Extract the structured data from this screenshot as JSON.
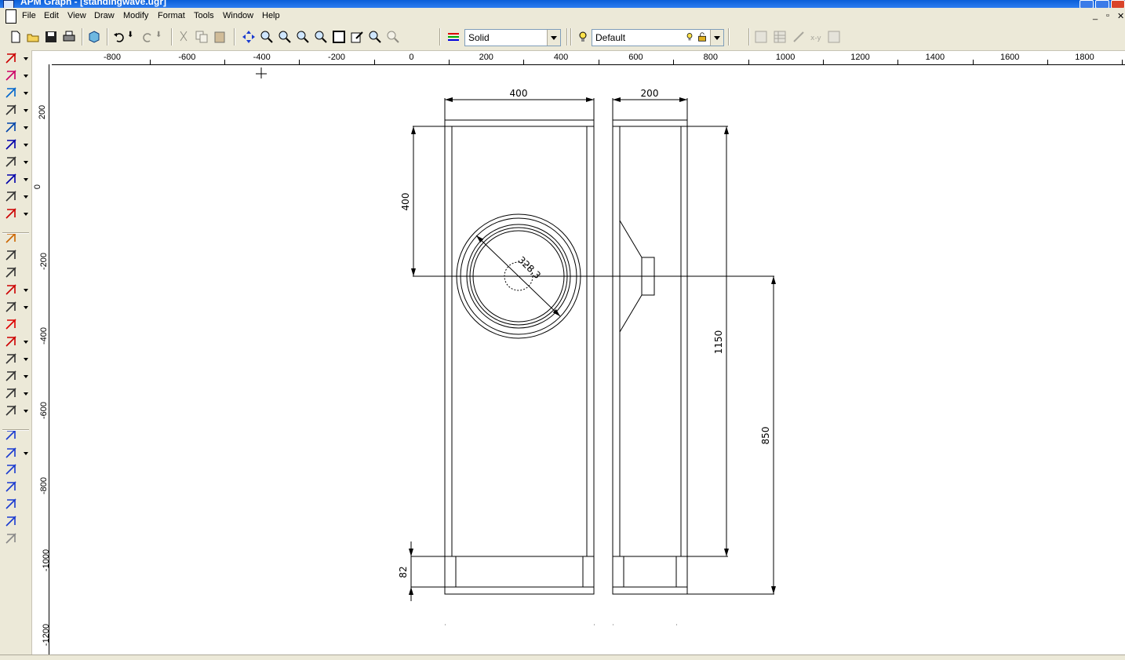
{
  "window": {
    "title": "APM Graph - [standingwave.ugr]"
  },
  "menu": {
    "items": [
      "File",
      "Edit",
      "View",
      "Draw",
      "Modify",
      "Format",
      "Tools",
      "Window",
      "Help"
    ]
  },
  "toolbar": {
    "line_style": "Solid",
    "layer": "Default",
    "icons": [
      "new-file-icon",
      "open-folder-icon",
      "save-icon",
      "print-icon",
      "3d-view-icon",
      "undo-icon",
      "redo-icon",
      "cut-icon",
      "copy-icon",
      "paste-icon",
      "pan-icon",
      "zoom-in-icon",
      "zoom-realtime-icon",
      "zoom-window-icon",
      "zoom-out-icon",
      "zoom-all-icon",
      "properties-icon",
      "zoom-previous-icon",
      "zoom-extents-icon",
      "line-style-icon",
      "layer-bulb-icon",
      "layer-lock-icon",
      "grid-icon",
      "table-icon",
      "snap-icon",
      "coordinates-icon",
      "calculator-icon"
    ]
  },
  "left_toolbar": {
    "tools": [
      "line-tool-icon",
      "arc-tool-icon",
      "spline-tool-icon",
      "point-tool-icon",
      "ellipse-tool-icon",
      "text-tool-icon",
      "hatch-tool-icon",
      "dimension-tool-icon",
      "block-tool-icon",
      "color-fill-tool-icon",
      "select-tool-icon",
      "move-tool-icon",
      "rotate-tool-icon",
      "mirror-tool-icon",
      "array-tool-icon",
      "delete-icon",
      "trim-tool-icon",
      "extend-tool-icon",
      "break-tool-icon",
      "offset-tool-icon",
      "scale-tool-icon",
      "snap-select-icon",
      "snap-arc-icon",
      "snap-center-icon",
      "snap-parallel-icon",
      "snap-dimension-icon",
      "snap-chain-icon",
      "snap-cylinder-icon"
    ]
  },
  "rulers": {
    "horizontal": [
      "-800",
      "-600",
      "-400",
      "-200",
      "0",
      "200",
      "400",
      "600",
      "800",
      "1000",
      "1200",
      "1400",
      "1600",
      "1800"
    ],
    "vertical": [
      "200",
      "0",
      "-200",
      "-400",
      "-600",
      "-800",
      "-1000",
      "-1200"
    ]
  },
  "drawing": {
    "dim_front_width": "400",
    "dim_side_width": "200",
    "dim_top_height": "400",
    "dim_driver_diameter": "328,3",
    "dim_main_height": "1150",
    "dim_lower_height": "850",
    "dim_foot_height": "82"
  }
}
